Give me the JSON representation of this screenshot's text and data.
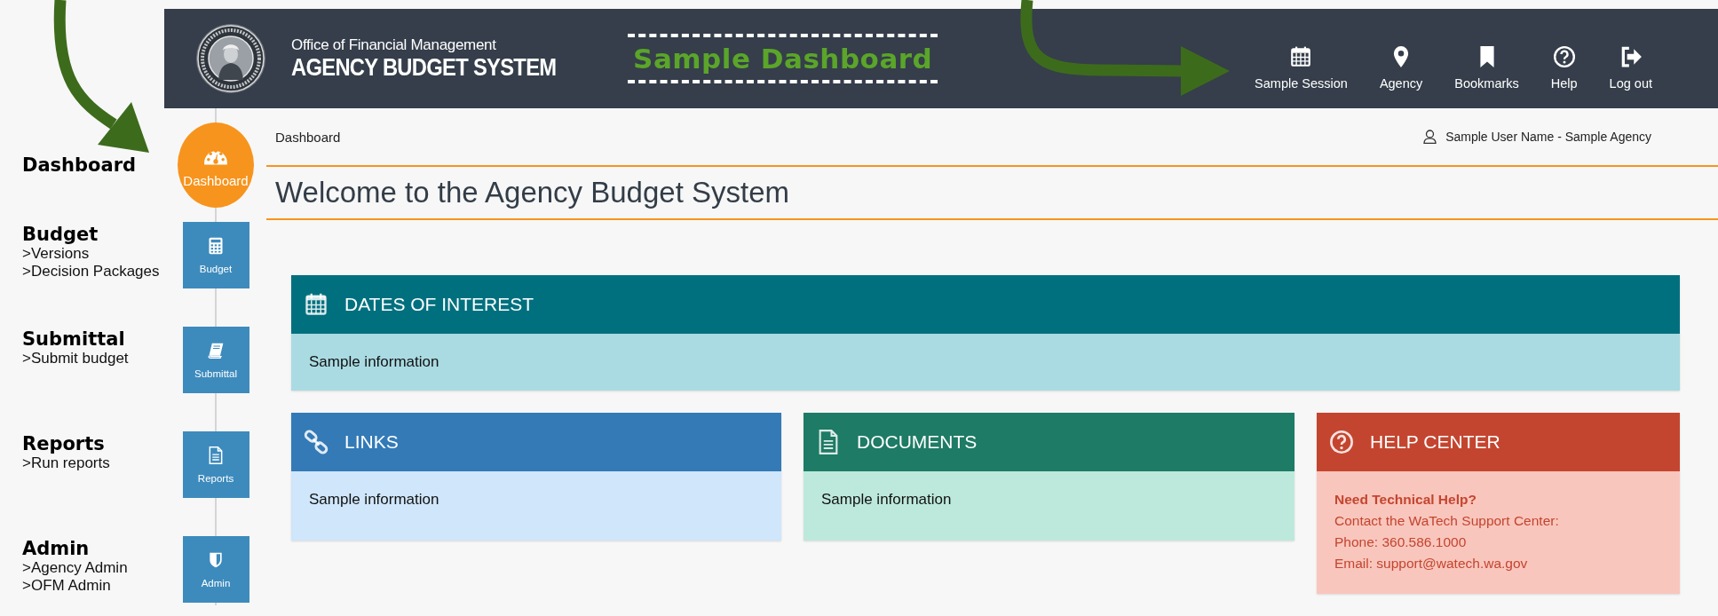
{
  "header": {
    "org": "Office of Financial Management",
    "system": "AGENCY BUDGET SYSTEM",
    "banner": "Sample Dashboard",
    "nav": [
      {
        "label": "Sample Session"
      },
      {
        "label": "Agency"
      },
      {
        "label": "Bookmarks"
      },
      {
        "label": "Help"
      },
      {
        "label": "Log out"
      }
    ]
  },
  "sidebar": [
    {
      "label": "Dashboard",
      "selected": true,
      "note": {
        "title": "Dashboard"
      }
    },
    {
      "label": "Budget",
      "selected": false,
      "note": {
        "title": "Budget",
        "items": [
          ">Versions",
          ">Decision Packages"
        ]
      }
    },
    {
      "label": "Submittal",
      "selected": false,
      "note": {
        "title": "Submittal",
        "items": [
          ">Submit budget"
        ]
      }
    },
    {
      "label": "Reports",
      "selected": false,
      "note": {
        "title": "Reports",
        "items": [
          ">Run reports"
        ]
      }
    },
    {
      "label": "Admin",
      "selected": false,
      "note": {
        "title": "Admin",
        "items": [
          ">Agency Admin",
          ">OFM Admin"
        ]
      }
    }
  ],
  "breadcrumb": "Dashboard",
  "user": "Sample User Name - Sample Agency",
  "title": "Welcome to the Agency Budget System",
  "cards": [
    {
      "title": "DATES OF INTEREST",
      "color": "#00707f",
      "lines": [
        {
          "text": "Sample information",
          "bold": false
        }
      ]
    },
    {
      "title": "LINKS",
      "color": "#337ab7",
      "lines": [
        {
          "text": "Sample information",
          "bold": false
        }
      ]
    },
    {
      "title": "DOCUMENTS",
      "color": "#1e7b65",
      "lines": [
        {
          "text": "Sample information",
          "bold": false
        }
      ]
    },
    {
      "title": "HELP CENTER",
      "color": "#c4452f",
      "lines": [
        {
          "text": "Need Technical Help?",
          "bold": true
        },
        {
          "text": "Contact the WaTech Support Center:",
          "bold": false
        },
        {
          "text": "Phone: 360.586.1000",
          "bold": false
        },
        {
          "text": "Email: support@watech.wa.gov",
          "bold": false
        }
      ]
    }
  ]
}
